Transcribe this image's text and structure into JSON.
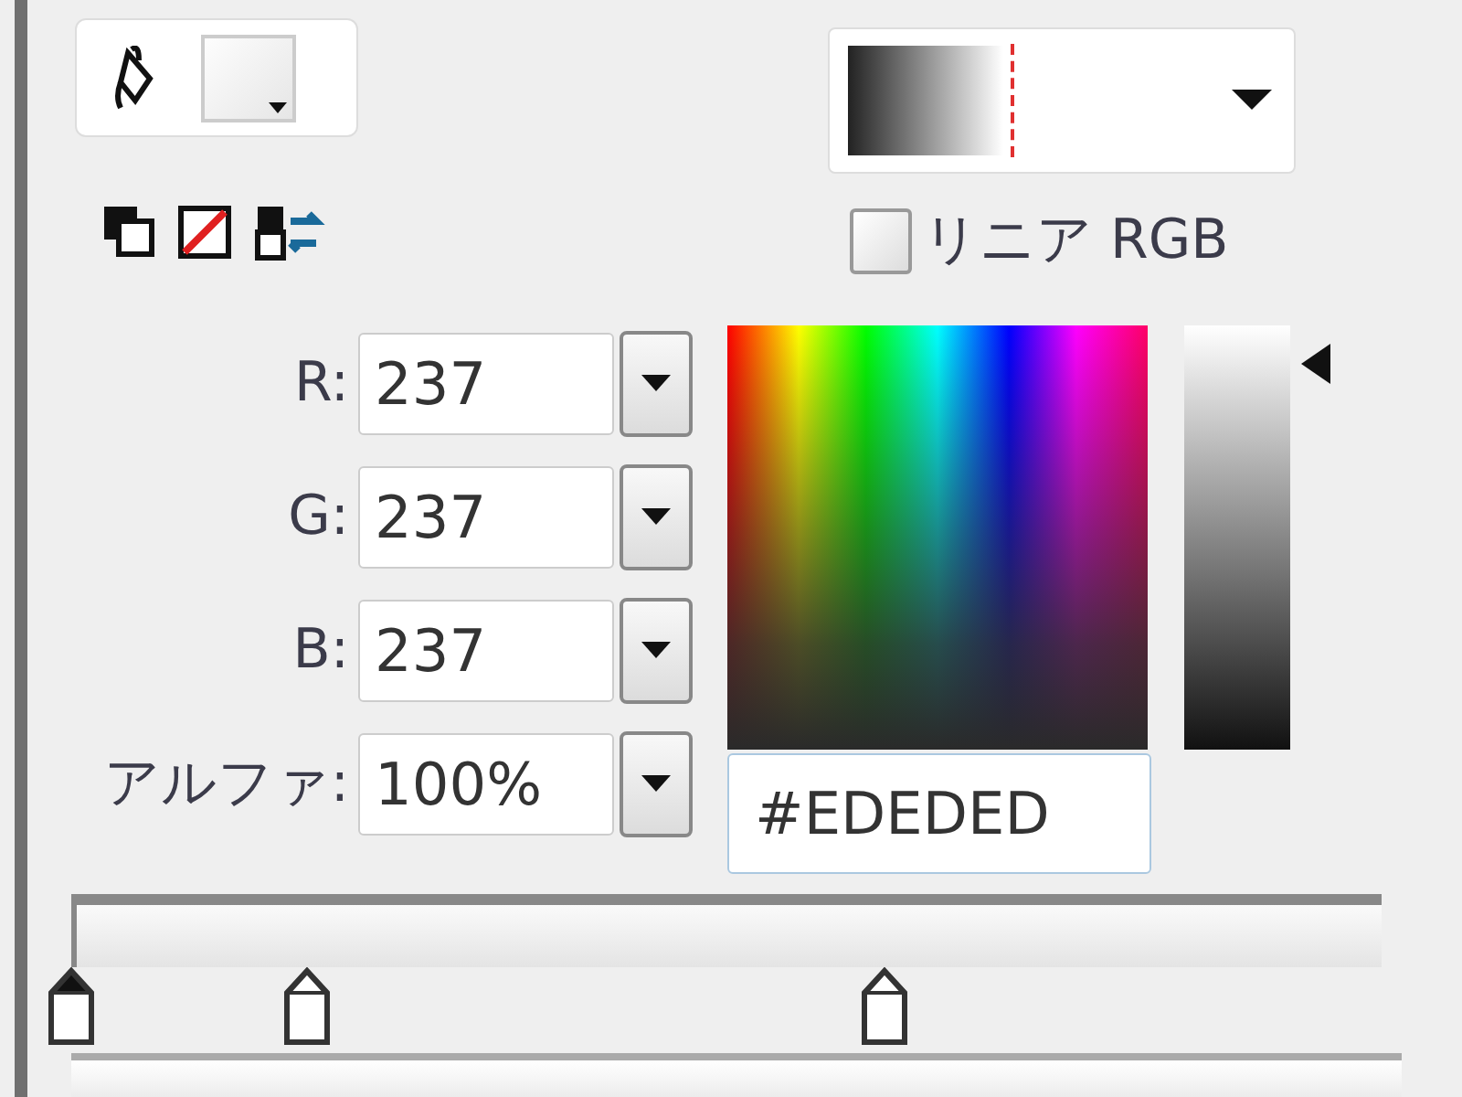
{
  "linear_rgb": {
    "label": "リニア RGB",
    "checked": false
  },
  "channels": [
    {
      "label": "R:",
      "value": "237"
    },
    {
      "label": "G:",
      "value": "237"
    },
    {
      "label": "B:",
      "value": "237"
    },
    {
      "label": "アルファ:",
      "value": "100%"
    }
  ],
  "hex": {
    "value": "#EDEDED"
  },
  "brightness": {
    "level": 0.91
  },
  "gradient_stops": [
    {
      "level": 0.0,
      "selected": true
    },
    {
      "level": 0.18,
      "selected": false
    },
    {
      "level": 0.62,
      "selected": false
    }
  ]
}
